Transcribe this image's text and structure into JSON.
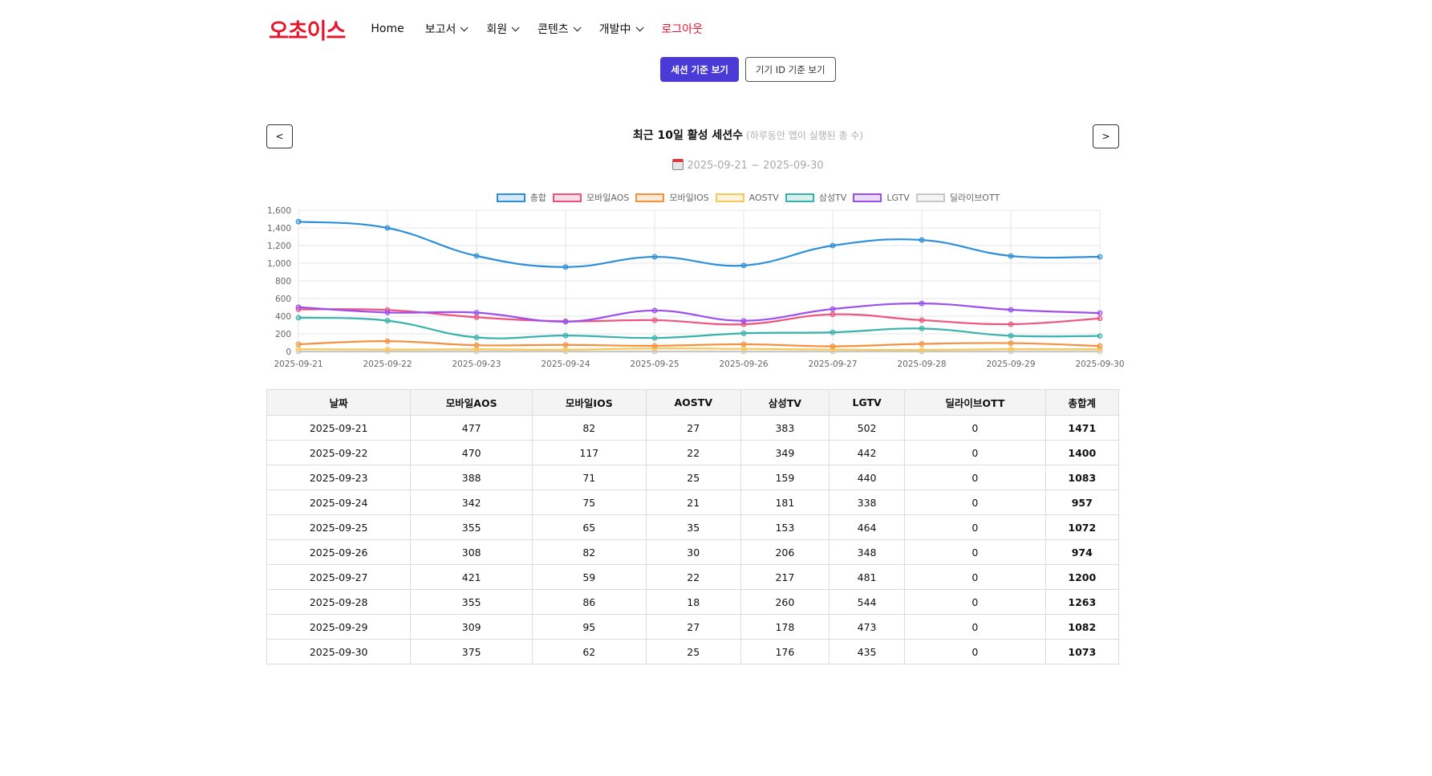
{
  "nav": {
    "logo": "오초이스",
    "items": [
      {
        "label": "Home",
        "dropdown": false
      },
      {
        "label": "보고서",
        "dropdown": true
      },
      {
        "label": "회원",
        "dropdown": true
      },
      {
        "label": "콘텐츠",
        "dropdown": true
      },
      {
        "label": "개발中",
        "dropdown": true
      }
    ],
    "logout": "로그아웃"
  },
  "view_toggle": {
    "session": "세션 기준 보기",
    "device": "기기 ID 기준 보기"
  },
  "pager": {
    "prev": "<",
    "next": ">"
  },
  "chart_header": {
    "title": "최근 10일 활성 세션수",
    "subtitle": "(하루동안 앱이 실행된 총 수)",
    "date_range": "2025-09-21 ~ 2025-09-30"
  },
  "colors": {
    "accent": "#4a3bd6",
    "logo": "#e8142c",
    "total": "#2d8fdc",
    "aos": "#f0547c",
    "ios": "#f5913e",
    "aostv": "#f9c85a",
    "samsungtv": "#38b2ac",
    "lgtv": "#9b4ff0",
    "dealive": "#c8c8c8"
  },
  "chart_data": {
    "type": "line",
    "categories": [
      "2025-09-21",
      "2025-09-22",
      "2025-09-23",
      "2025-09-24",
      "2025-09-25",
      "2025-09-26",
      "2025-09-27",
      "2025-09-28",
      "2025-09-29",
      "2025-09-30"
    ],
    "ylim": [
      0,
      1600
    ],
    "yticks": [
      0,
      200,
      400,
      600,
      800,
      1000,
      1200,
      1400,
      1600
    ],
    "ytick_labels": [
      "0",
      "200",
      "400",
      "600",
      "800",
      "1,000",
      "1,200",
      "1,400",
      "1,600"
    ],
    "grid": true,
    "legend_position": "top-center",
    "series": [
      {
        "name": "총합",
        "color": "#2d8fdc",
        "values": [
          1471,
          1400,
          1083,
          957,
          1072,
          974,
          1200,
          1263,
          1082,
          1073
        ]
      },
      {
        "name": "모바일AOS",
        "color": "#f0547c",
        "values": [
          477,
          470,
          388,
          342,
          355,
          308,
          421,
          355,
          309,
          375
        ]
      },
      {
        "name": "모바일IOS",
        "color": "#f5913e",
        "values": [
          82,
          117,
          71,
          75,
          65,
          82,
          59,
          86,
          95,
          62
        ]
      },
      {
        "name": "AOSTV",
        "color": "#f9c85a",
        "values": [
          27,
          22,
          25,
          21,
          35,
          30,
          22,
          18,
          27,
          25
        ]
      },
      {
        "name": "삼성TV",
        "color": "#38b2ac",
        "values": [
          383,
          349,
          159,
          181,
          153,
          206,
          217,
          260,
          178,
          176
        ]
      },
      {
        "name": "LGTV",
        "color": "#9b4ff0",
        "values": [
          502,
          442,
          440,
          338,
          464,
          348,
          481,
          544,
          473,
          435
        ]
      },
      {
        "name": "딜라이브OTT",
        "color": "#c8c8c8",
        "values": [
          0,
          0,
          0,
          0,
          0,
          0,
          0,
          0,
          0,
          0
        ]
      }
    ]
  },
  "table": {
    "headers": [
      "날짜",
      "모바일AOS",
      "모바일IOS",
      "AOSTV",
      "삼성TV",
      "LGTV",
      "딜라이브OTT",
      "총합계"
    ],
    "rows": [
      [
        "2025-09-21",
        "477",
        "82",
        "27",
        "383",
        "502",
        "0",
        "1471"
      ],
      [
        "2025-09-22",
        "470",
        "117",
        "22",
        "349",
        "442",
        "0",
        "1400"
      ],
      [
        "2025-09-23",
        "388",
        "71",
        "25",
        "159",
        "440",
        "0",
        "1083"
      ],
      [
        "2025-09-24",
        "342",
        "75",
        "21",
        "181",
        "338",
        "0",
        "957"
      ],
      [
        "2025-09-25",
        "355",
        "65",
        "35",
        "153",
        "464",
        "0",
        "1072"
      ],
      [
        "2025-09-26",
        "308",
        "82",
        "30",
        "206",
        "348",
        "0",
        "974"
      ],
      [
        "2025-09-27",
        "421",
        "59",
        "22",
        "217",
        "481",
        "0",
        "1200"
      ],
      [
        "2025-09-28",
        "355",
        "86",
        "18",
        "260",
        "544",
        "0",
        "1263"
      ],
      [
        "2025-09-29",
        "309",
        "95",
        "27",
        "178",
        "473",
        "0",
        "1082"
      ],
      [
        "2025-09-30",
        "375",
        "62",
        "25",
        "176",
        "435",
        "0",
        "1073"
      ]
    ]
  }
}
